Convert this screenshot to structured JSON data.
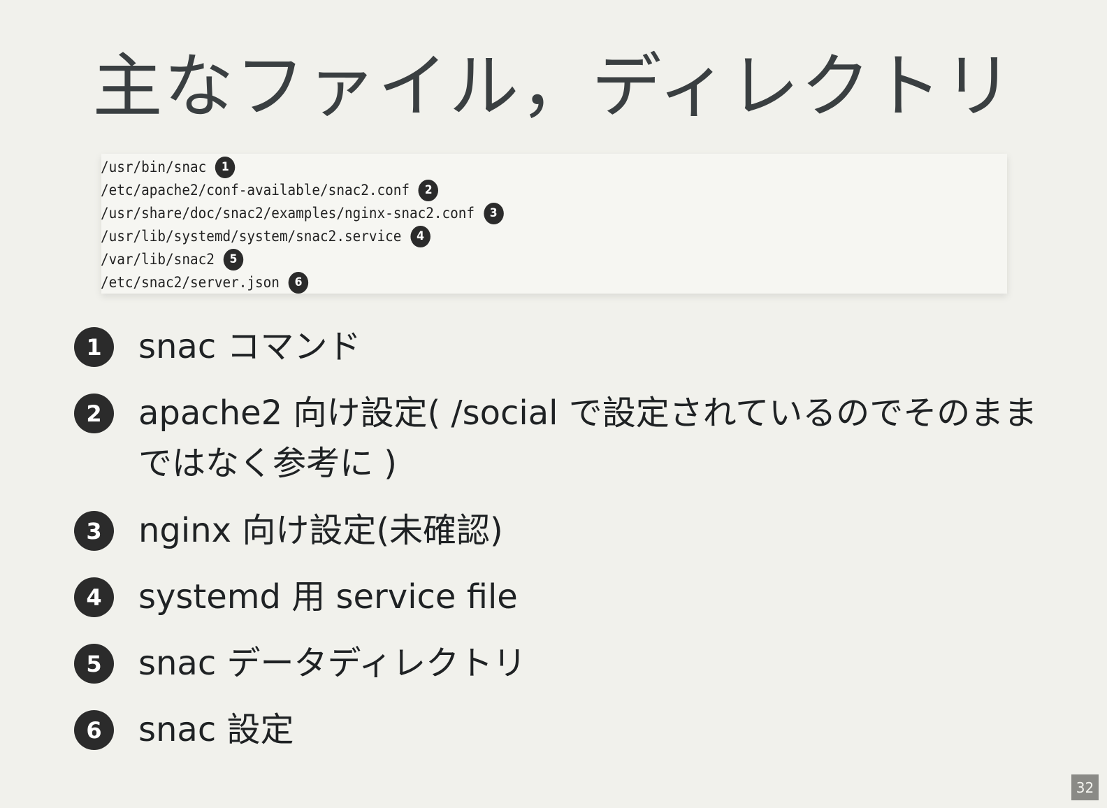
{
  "title": "主なファイル，ディレクトリ",
  "code_lines": [
    {
      "path": "/usr/bin/snac",
      "callout": "1"
    },
    {
      "path": "/etc/apache2/conf-available/snac2.conf",
      "callout": "2"
    },
    {
      "path": "/usr/share/doc/snac2/examples/nginx-snac2.conf",
      "callout": "3"
    },
    {
      "path": "/usr/lib/systemd/system/snac2.service",
      "callout": "4"
    },
    {
      "path": "/var/lib/snac2",
      "callout": "5"
    },
    {
      "path": "/etc/snac2/server.json",
      "callout": "6"
    }
  ],
  "items": [
    {
      "num": "1",
      "text": "snac コマンド"
    },
    {
      "num": "2",
      "text": "apache2 向け設定( /social で設定されているのでそのままではなく参考に )"
    },
    {
      "num": "3",
      "text": "nginx 向け設定(未確認)"
    },
    {
      "num": "4",
      "text": "systemd 用 service file"
    },
    {
      "num": "5",
      "text": "snac データディレクトリ"
    },
    {
      "num": "6",
      "text": "snac 設定"
    }
  ],
  "page_number": "32"
}
